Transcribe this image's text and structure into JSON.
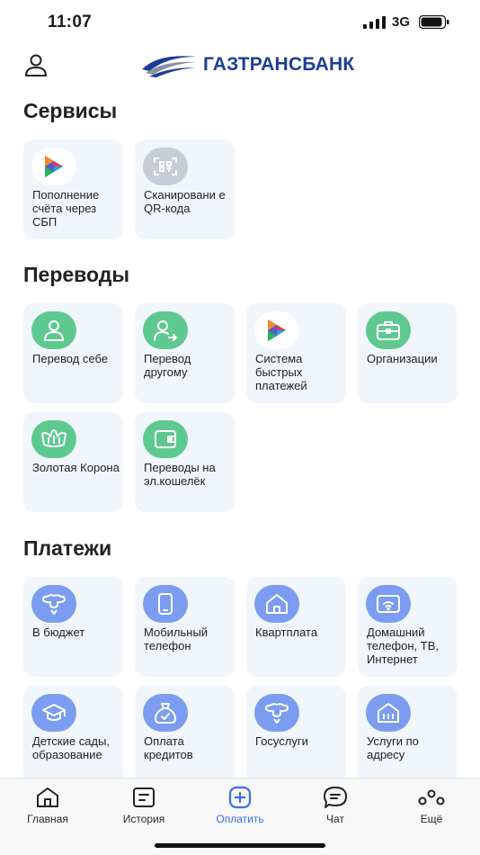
{
  "status": {
    "time": "11:07",
    "network": "3G"
  },
  "header": {
    "logo_text": "ГАЗТРАНСБАНК"
  },
  "services": {
    "title": "Сервисы",
    "items": [
      {
        "label": "Пополнение счёта через СБП",
        "icon": "sbp-icon"
      },
      {
        "label": "Сканировани е QR-кода",
        "icon": "qr-scan-icon"
      }
    ]
  },
  "transfers": {
    "title": "Переводы",
    "items": [
      {
        "label": "Перевод себе",
        "icon": "person-icon"
      },
      {
        "label": "Перевод другому",
        "icon": "person-arrow-icon"
      },
      {
        "label": "Система быстрых платежей",
        "icon": "sbp-icon"
      },
      {
        "label": "Организации",
        "icon": "briefcase-icon"
      },
      {
        "label": "Золотая Корона",
        "icon": "crown-icon"
      },
      {
        "label": "Переводы на эл.кошелёк",
        "icon": "wallet-icon"
      }
    ]
  },
  "payments": {
    "title": "Платежи",
    "items": [
      {
        "label": "В бюджет",
        "icon": "emblem-icon"
      },
      {
        "label": "Мобильный телефон",
        "icon": "phone-icon"
      },
      {
        "label": "Квартплата",
        "icon": "house-icon"
      },
      {
        "label": "Домашний телефон, ТВ, Интернет",
        "icon": "router-icon"
      },
      {
        "label": "Детские сады, образование",
        "icon": "graduation-cap-icon"
      },
      {
        "label": "Оплата кредитов",
        "icon": "money-bag-icon"
      },
      {
        "label": "Госуслуги",
        "icon": "emblem-icon"
      },
      {
        "label": "Услуги по адресу",
        "icon": "building-icon"
      }
    ]
  },
  "tabbar": {
    "items": [
      {
        "label": "Главная",
        "icon": "home-icon"
      },
      {
        "label": "История",
        "icon": "history-icon"
      },
      {
        "label": "Оплатить",
        "icon": "plus-square-icon",
        "active": true
      },
      {
        "label": "Чат",
        "icon": "chat-icon"
      },
      {
        "label": "Ещё",
        "icon": "more-icon"
      }
    ]
  },
  "colors": {
    "brand": "#1e3d9b",
    "accent": "#3a6df0",
    "green": "#5ec98f",
    "blue": "#7b9cf0",
    "tile_bg": "#f1f6fd"
  }
}
